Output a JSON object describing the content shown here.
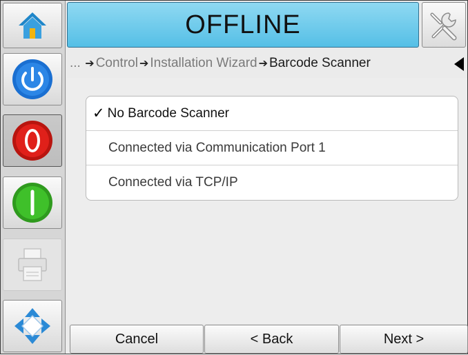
{
  "header": {
    "status": "OFFLINE"
  },
  "breadcrumb": {
    "ellipsis": "...",
    "items": [
      "Control",
      "Installation Wizard"
    ],
    "current": "Barcode Scanner"
  },
  "options": [
    {
      "label": "No Barcode Scanner",
      "selected": true
    },
    {
      "label": "Connected via Communication Port 1",
      "selected": false
    },
    {
      "label": "Connected via TCP/IP",
      "selected": false
    }
  ],
  "check_mark": "✓",
  "footer": {
    "cancel_label": "Cancel",
    "back_label": "< Back",
    "next_label": "Next >"
  },
  "sidebar": {
    "icons": [
      "home-icon",
      "power-icon",
      "stop-icon",
      "start-icon",
      "printer-icon",
      "navigation-icon"
    ]
  },
  "colors": {
    "status_bar": "#55bfe6",
    "power": "#1a6fd1",
    "stop": "#e0201a",
    "start": "#3fc02a"
  }
}
